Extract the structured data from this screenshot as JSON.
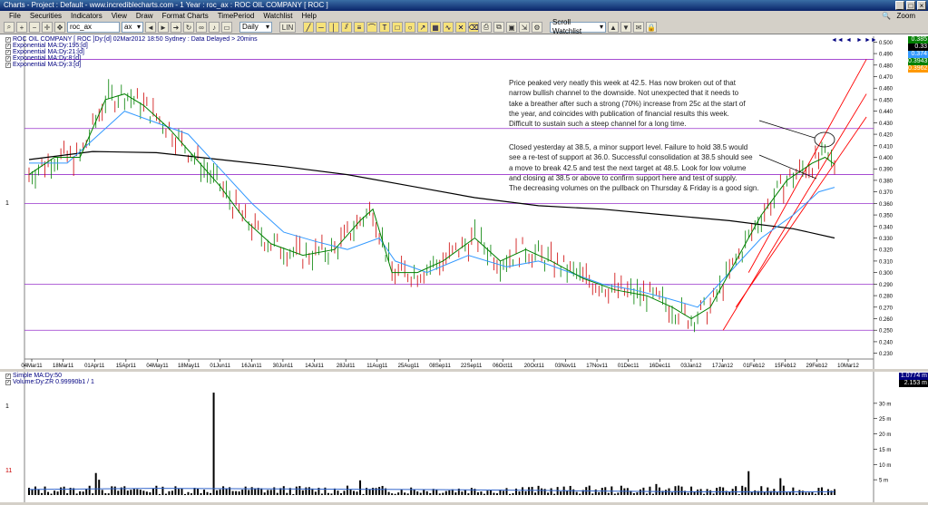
{
  "window": {
    "title": "Charts - Project : Default - www.incrediblecharts.com - 1 Year : roc_ax : ROC OIL COMPANY [ ROC ]"
  },
  "menu": [
    "File",
    "Securities",
    "Indicators",
    "View",
    "Draw",
    "Format Charts",
    "TimePeriod",
    "Watchlist",
    "Help"
  ],
  "menu_zoom": "Zoom",
  "toolbar": {
    "security_value": "roc_ax",
    "exchange_value": "ax",
    "period_value": "Daily",
    "watchlist_value": "Scroll Watchlist",
    "lin_label": "LIN"
  },
  "price_panel": {
    "header": "ROC OIL COMPANY [ ROC ]Dy:[d] 02Mar2012 18:50 Sydney : Data Delayed > 20mins",
    "legend": [
      "Exponential MA:Dy:195:[d]",
      "Exponential MA:Dy:21:[d]",
      "Exponential MA:Dy:8:[d]",
      "Exponential MA:Dy:3:[d]"
    ],
    "value_boxes": [
      {
        "text": "0.385",
        "color": "#008000"
      },
      {
        "text": "0.33",
        "color": "#000000"
      },
      {
        "text": "0.374",
        "color": "#3399ff"
      },
      {
        "text": "0.3943",
        "color": "#008000"
      },
      {
        "text": "0.3962",
        "color": "#ff9900"
      }
    ],
    "y_ticks": [
      "0.500",
      "0.490",
      "0.480",
      "0.470",
      "0.460",
      "0.450",
      "0.440",
      "0.430",
      "0.420",
      "0.410",
      "0.400",
      "0.390",
      "0.380",
      "0.370",
      "0.360",
      "0.350",
      "0.340",
      "0.330",
      "0.320",
      "0.310",
      "0.300",
      "0.290",
      "0.280",
      "0.270",
      "0.260",
      "0.250",
      "0.240",
      "0.230"
    ],
    "x_ticks": [
      "04Mar11",
      "18Mar11",
      "01Apr11",
      "15Apr11",
      "04May11",
      "18May11",
      "01Jun11",
      "16Jun11",
      "30Jun11",
      "14Jul11",
      "28Jul11",
      "11Aug11",
      "25Aug11",
      "08Sep11",
      "22Sep11",
      "06Oct11",
      "20Oct11",
      "03Nov11",
      "17Nov11",
      "01Dec11",
      "16Dec11",
      "03Jan12",
      "17Jan12",
      "01Feb12",
      "15Feb12",
      "29Feb12",
      "10Mar12"
    ],
    "left_marker": "1"
  },
  "annotations": {
    "note1": [
      "Price peaked very neatly this week at 42.5. Has now broken out of that",
      "narrow bullish channel to the downside. Not unexpected that it needs to",
      "take a breather after such a strong (70%) increase from 25c at the start of",
      "the year, and coincides with publication of financial results this week.",
      "Difficult to sustain such a steep channel for a long time."
    ],
    "note2": [
      "Closed yesterday at 38.5, a minor support level. Failure to hold 38.5 would",
      "see a re-test of support at 36.0. Successful consolidation at 38.5 should see",
      "a move to break 42.5 and test the next target at 48.5. Look for low volume",
      "and closing at 38.5 or above to confirm support here and test of supply.",
      "The decreasing volumes on the pullback on Thursday & Friday is a good sign."
    ]
  },
  "volume_panel": {
    "legend": [
      "Simple MA:Dy:50",
      "Volume:Dy:ZR 0.99990b1 / 1"
    ],
    "value_boxes": [
      {
        "text": "1.0774 m",
        "color": "#000080"
      },
      {
        "text": "2.153 m",
        "color": "#000000"
      }
    ],
    "y_ticks": [
      "30 m",
      "25 m",
      "20 m",
      "15 m",
      "10 m",
      "5 m"
    ],
    "left_markers": [
      "1",
      "11"
    ]
  },
  "colors": {
    "ma195": "#000000",
    "ma21": "#3399ff",
    "ma8": "#008000",
    "ma3": "#ff9900",
    "level_lines": "#9933cc",
    "channel": "#ff0000",
    "up_bar": "#008000",
    "down_bar": "#cc0000"
  },
  "chart_data": {
    "type": "line",
    "title": "ROC OIL COMPANY [ ROC ]",
    "ylim": [
      0.225,
      0.505
    ],
    "horizontal_levels": [
      0.485,
      0.425,
      0.385,
      0.36,
      0.29,
      0.25
    ],
    "ma195": [
      [
        0,
        0.398
      ],
      [
        20,
        0.405
      ],
      [
        40,
        0.404
      ],
      [
        60,
        0.398
      ],
      [
        80,
        0.392
      ],
      [
        100,
        0.385
      ],
      [
        120,
        0.375
      ],
      [
        140,
        0.365
      ],
      [
        160,
        0.358
      ],
      [
        180,
        0.355
      ],
      [
        200,
        0.35
      ],
      [
        220,
        0.345
      ],
      [
        240,
        0.338
      ],
      [
        253,
        0.33
      ]
    ],
    "ma21": [
      [
        0,
        0.395
      ],
      [
        12,
        0.395
      ],
      [
        22,
        0.42
      ],
      [
        30,
        0.44
      ],
      [
        40,
        0.43
      ],
      [
        50,
        0.42
      ],
      [
        60,
        0.39
      ],
      [
        70,
        0.36
      ],
      [
        80,
        0.335
      ],
      [
        90,
        0.327
      ],
      [
        100,
        0.32
      ],
      [
        110,
        0.33
      ],
      [
        115,
        0.31
      ],
      [
        125,
        0.3
      ],
      [
        138,
        0.315
      ],
      [
        150,
        0.305
      ],
      [
        160,
        0.31
      ],
      [
        170,
        0.3
      ],
      [
        180,
        0.29
      ],
      [
        190,
        0.285
      ],
      [
        200,
        0.278
      ],
      [
        210,
        0.27
      ],
      [
        220,
        0.3
      ],
      [
        230,
        0.33
      ],
      [
        240,
        0.35
      ],
      [
        248,
        0.37
      ],
      [
        253,
        0.374
      ]
    ],
    "ma8": [
      [
        0,
        0.385
      ],
      [
        8,
        0.4
      ],
      [
        16,
        0.4
      ],
      [
        24,
        0.45
      ],
      [
        30,
        0.455
      ],
      [
        36,
        0.445
      ],
      [
        44,
        0.425
      ],
      [
        52,
        0.4
      ],
      [
        60,
        0.375
      ],
      [
        68,
        0.345
      ],
      [
        76,
        0.325
      ],
      [
        86,
        0.315
      ],
      [
        96,
        0.32
      ],
      [
        104,
        0.345
      ],
      [
        108,
        0.355
      ],
      [
        114,
        0.3
      ],
      [
        122,
        0.3
      ],
      [
        130,
        0.31
      ],
      [
        140,
        0.33
      ],
      [
        148,
        0.31
      ],
      [
        156,
        0.32
      ],
      [
        164,
        0.31
      ],
      [
        174,
        0.295
      ],
      [
        184,
        0.285
      ],
      [
        194,
        0.28
      ],
      [
        202,
        0.27
      ],
      [
        208,
        0.26
      ],
      [
        214,
        0.27
      ],
      [
        222,
        0.31
      ],
      [
        230,
        0.35
      ],
      [
        238,
        0.38
      ],
      [
        246,
        0.395
      ],
      [
        250,
        0.4
      ],
      [
        253,
        0.394
      ]
    ],
    "volume_ma": [
      [
        0,
        1.8
      ],
      [
        40,
        2.2
      ],
      [
        80,
        2.0
      ],
      [
        120,
        1.8
      ],
      [
        160,
        1.5
      ],
      [
        200,
        1.1
      ],
      [
        230,
        1.0
      ],
      [
        253,
        1.08
      ]
    ],
    "channel_lines": [
      {
        "from": [
          218,
          0.25
        ],
        "to": [
          263,
          0.455
        ]
      },
      {
        "from": [
          222,
          0.27
        ],
        "to": [
          263,
          0.435
        ]
      },
      {
        "from": [
          226,
          0.3
        ],
        "to": [
          263,
          0.485
        ]
      }
    ]
  }
}
